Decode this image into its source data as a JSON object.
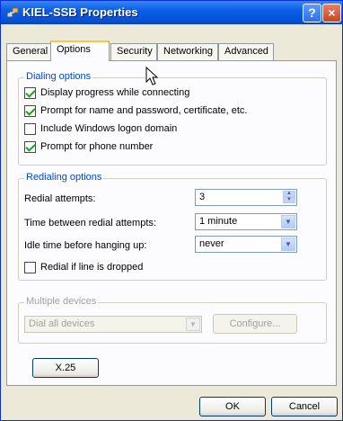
{
  "window": {
    "title": "KIEL-SSB Properties",
    "help_glyph": "?",
    "close_glyph": "×"
  },
  "tabs": [
    {
      "label": "General"
    },
    {
      "label": "Options",
      "active": true
    },
    {
      "label": "Security"
    },
    {
      "label": "Networking"
    },
    {
      "label": "Advanced"
    }
  ],
  "dialing": {
    "title": "Dialing options",
    "options": [
      {
        "label": "Display progress while connecting",
        "checked": true
      },
      {
        "label": "Prompt for name and password, certificate, etc.",
        "checked": true
      },
      {
        "label": "Include Windows logon domain",
        "checked": false
      },
      {
        "label": "Prompt for phone number",
        "checked": true
      }
    ]
  },
  "redialing": {
    "title": "Redialing options",
    "attempts_label": "Redial attempts:",
    "attempts_value": "3",
    "time_label": "Time between redial attempts:",
    "time_value": "1 minute",
    "idle_label": "Idle time before hanging up:",
    "idle_value": "never",
    "redial_drop_label": "Redial if line is dropped",
    "redial_drop_checked": false
  },
  "multiple": {
    "title": "Multiple devices",
    "select_value": "Dial all devices",
    "configure_label": "Configure..."
  },
  "x25_label": "X.25",
  "footer": {
    "ok_label": "OK",
    "cancel_label": "Cancel"
  },
  "colors": {
    "title_bar": "#0a5ee8",
    "group_title": "#0046d5",
    "active_tab_highlight": "#ffc83c",
    "dialog_bg": "#ece9d8"
  }
}
